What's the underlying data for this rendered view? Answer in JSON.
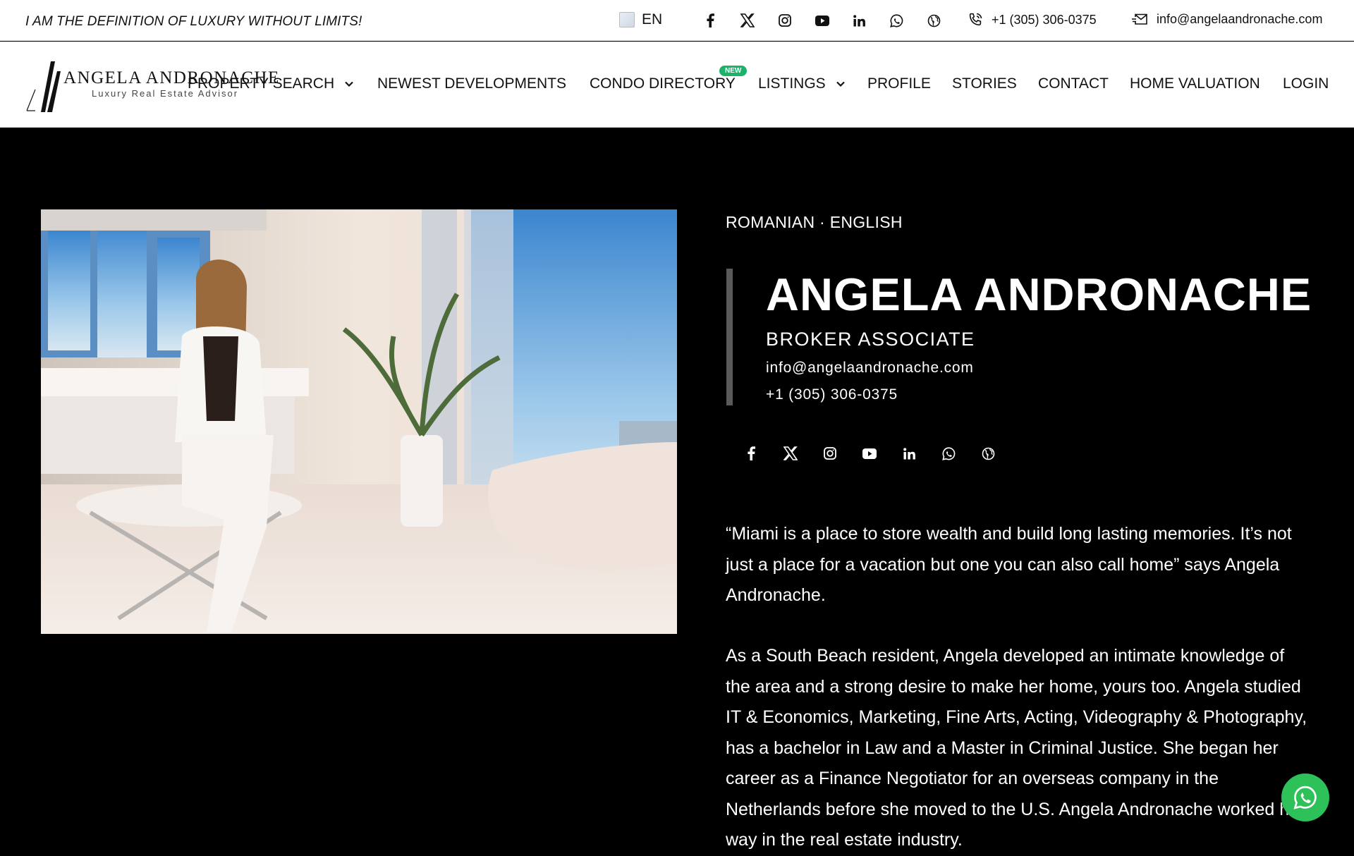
{
  "topbar": {
    "tagline": "I AM THE DEFINITION OF LUXURY WITHOUT LIMITS!",
    "language": "EN",
    "phone": "+1 (305) 306-0375",
    "email": "info@angelaandronache.com",
    "social_icons": [
      "facebook-icon",
      "x-icon",
      "instagram-icon",
      "youtube-icon",
      "linkedin-icon",
      "whatsapp-icon",
      "globe-icon"
    ]
  },
  "logo": {
    "name": "ANGELA ANDRONACHE",
    "subtitle": "Luxury Real Estate Advisor"
  },
  "nav": {
    "items": [
      {
        "label": "PROPERTY SEARCH",
        "dropdown": true
      },
      {
        "label": "NEWEST DEVELOPMENTS",
        "dropdown": false
      },
      {
        "label": "CONDO DIRECTORY",
        "dropdown": false,
        "badge": "NEW"
      },
      {
        "label": "LISTINGS",
        "dropdown": true
      },
      {
        "label": "PROFILE",
        "dropdown": false
      },
      {
        "label": "STORIES",
        "dropdown": false
      },
      {
        "label": "CONTACT",
        "dropdown": false
      },
      {
        "label": "HOME VALUATION",
        "dropdown": false
      },
      {
        "label": "LOGIN",
        "dropdown": false
      }
    ]
  },
  "hero": {
    "languages": "ROMANIAN · ENGLISH",
    "name": "ANGELA ANDRONACHE",
    "role": "BROKER ASSOCIATE",
    "email": "info@angelaandronache.com",
    "phone": "+1 (305) 306-0375",
    "quote": "“Miami is a place to store wealth and build long lasting memories. It’s not just a place for a vacation but one you can also call home” says Angela Andronache.",
    "bio": "As a South Beach resident, Angela developed an intimate knowledge of the area and a strong desire to make her home, yours too. Angela studied IT & Economics, Marketing, Fine Arts, Acting, Videography & Photography, has a bachelor in Law and a Master in Criminal Justice. She began her career as a Finance Negotiator for an overseas company in the Netherlands before she moved to the U.S. Angela Andronache worked her way in the real estate industry."
  },
  "colors": {
    "accent_green": "#1bb36a",
    "whatsapp_green": "#2ec15a",
    "background": "#000000"
  }
}
